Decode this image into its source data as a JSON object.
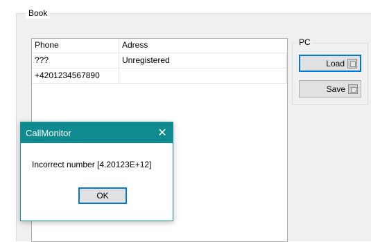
{
  "book": {
    "legend": "Book",
    "columns": [
      "Phone",
      "Adress"
    ],
    "rows": [
      {
        "phone": "???",
        "address": "Unregistered"
      },
      {
        "phone": "+4201234567890",
        "address": ""
      }
    ]
  },
  "pc": {
    "legend": "PC",
    "load_label": "Load",
    "save_label": "Save"
  },
  "dialog": {
    "title": "CallMonitor",
    "close_glyph": "✕",
    "message": "Incorrect number [4.20123E+12]",
    "ok_label": "OK"
  },
  "colors": {
    "dialog_titlebar": "#0f8a8f",
    "focus_border": "#0078d7"
  },
  "icons": {
    "close": "close-icon",
    "button_glyph": "floppy-icon"
  }
}
